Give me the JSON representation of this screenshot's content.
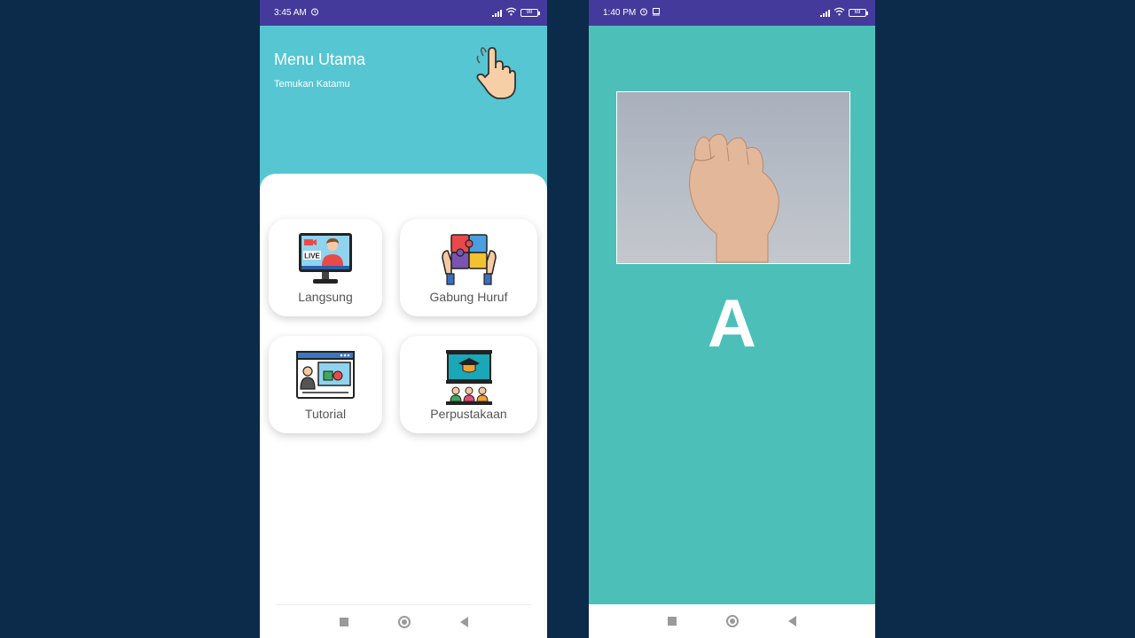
{
  "phone1": {
    "status": {
      "time": "3:45 AM",
      "battery": "98"
    },
    "header": {
      "title": "Menu Utama",
      "subtitle": "Temukan Katamu"
    },
    "menu": [
      {
        "label": "Langsung",
        "icon": "live-monitor-icon"
      },
      {
        "label": "Gabung Huruf",
        "icon": "puzzle-hands-icon"
      },
      {
        "label": "Tutorial",
        "icon": "tutorial-presentation-icon"
      },
      {
        "label": "Perpustakaan",
        "icon": "graduation-classroom-icon"
      }
    ],
    "live_badge": "LIVE"
  },
  "phone2": {
    "status": {
      "time": "1:40 PM",
      "battery": "69"
    },
    "detected_letter": "A"
  },
  "colors": {
    "statusbar": "#443a9c",
    "header": "#56c6d2",
    "camera_bg": "#4cc0b8",
    "background": "#0c2a4a"
  }
}
